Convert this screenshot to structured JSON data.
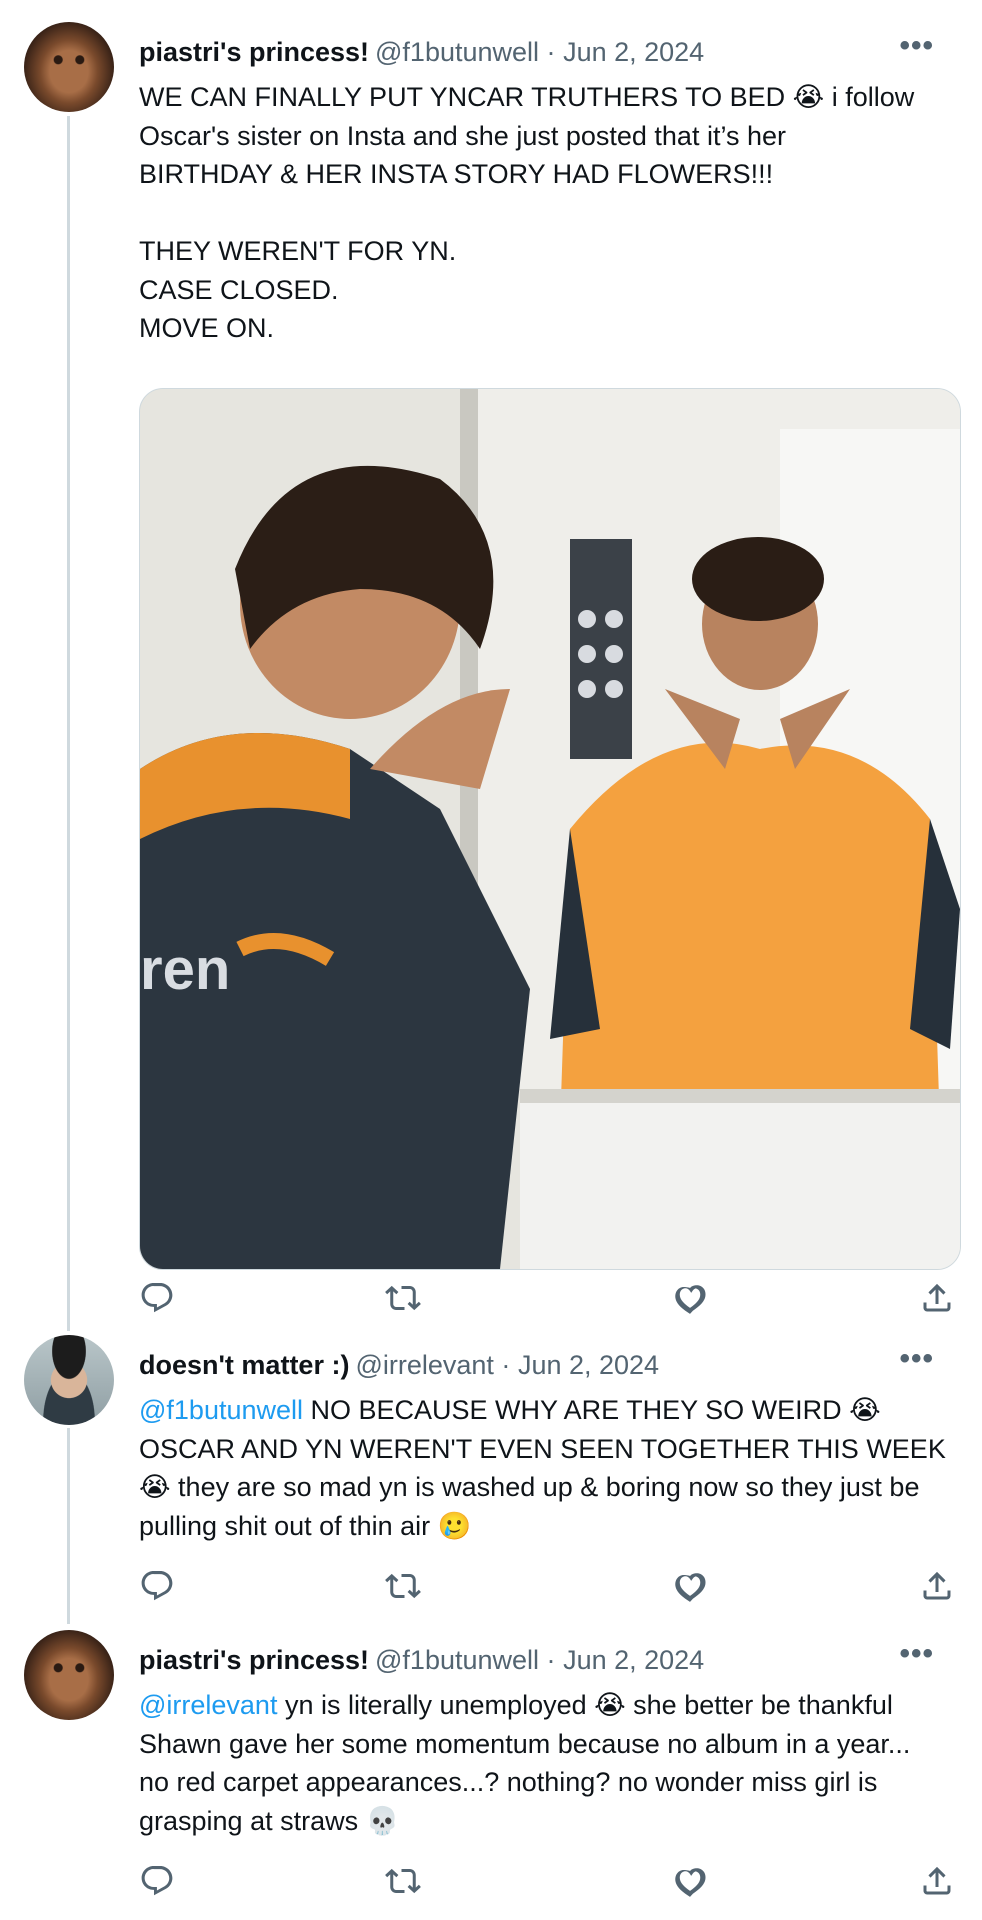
{
  "tweets": [
    {
      "display_name": "piastri's princess!",
      "handle": "@f1butunwell",
      "separator": "·",
      "date": "Jun 2, 2024",
      "more": "•••",
      "avatar": "cat-avatar",
      "text_lines": [
        "WE CAN FINALLY PUT YNCAR TRUTHERS TO BED 😭 i follow",
        "Oscar's sister on Insta and she just posted that it’s her",
        "BIRTHDAY & HER INSTA STORY HAD FLOWERS!!!",
        "",
        "THEY WEREN'T FOR YN.",
        "CASE CLOSED.",
        "MOVE ON."
      ],
      "has_media": true,
      "media_description": "man in orange team shirt posing in mirror"
    },
    {
      "display_name": "doesn't matter :)",
      "handle": "@irrelevant",
      "separator": "·",
      "date": "Jun 2, 2024",
      "more": "•••",
      "avatar": "person-avatar",
      "reply_to": "@f1butunwell",
      "text_lines": [
        " NO BECAUSE WHY ARE THEY SO WEIRD 😭",
        "OSCAR AND YN WEREN'T EVEN SEEN TOGETHER THIS WEEK",
        "😭 they are so mad yn is washed up & boring now so they just be",
        "pulling shit out of thin air 🥲"
      ]
    },
    {
      "display_name": "piastri's princess!",
      "handle": "@f1butunwell",
      "separator": "·",
      "date": "Jun 2, 2024",
      "more": "•••",
      "avatar": "cat-avatar",
      "reply_to": "@irrelevant",
      "text_lines": [
        " yn is literally unemployed 😭 she better be thankful",
        "Shawn gave her some momentum because no album in a year...",
        "no red carpet appearances...? nothing? no wonder miss girl is",
        "grasping at straws 💀"
      ]
    }
  ],
  "action_icons": [
    "reply-icon",
    "retweet-icon",
    "like-icon",
    "share-icon"
  ],
  "colors": {
    "text": "#0f1419",
    "secondary": "#536471",
    "link": "#1d9bf0",
    "thread_line": "#cfd9de"
  }
}
